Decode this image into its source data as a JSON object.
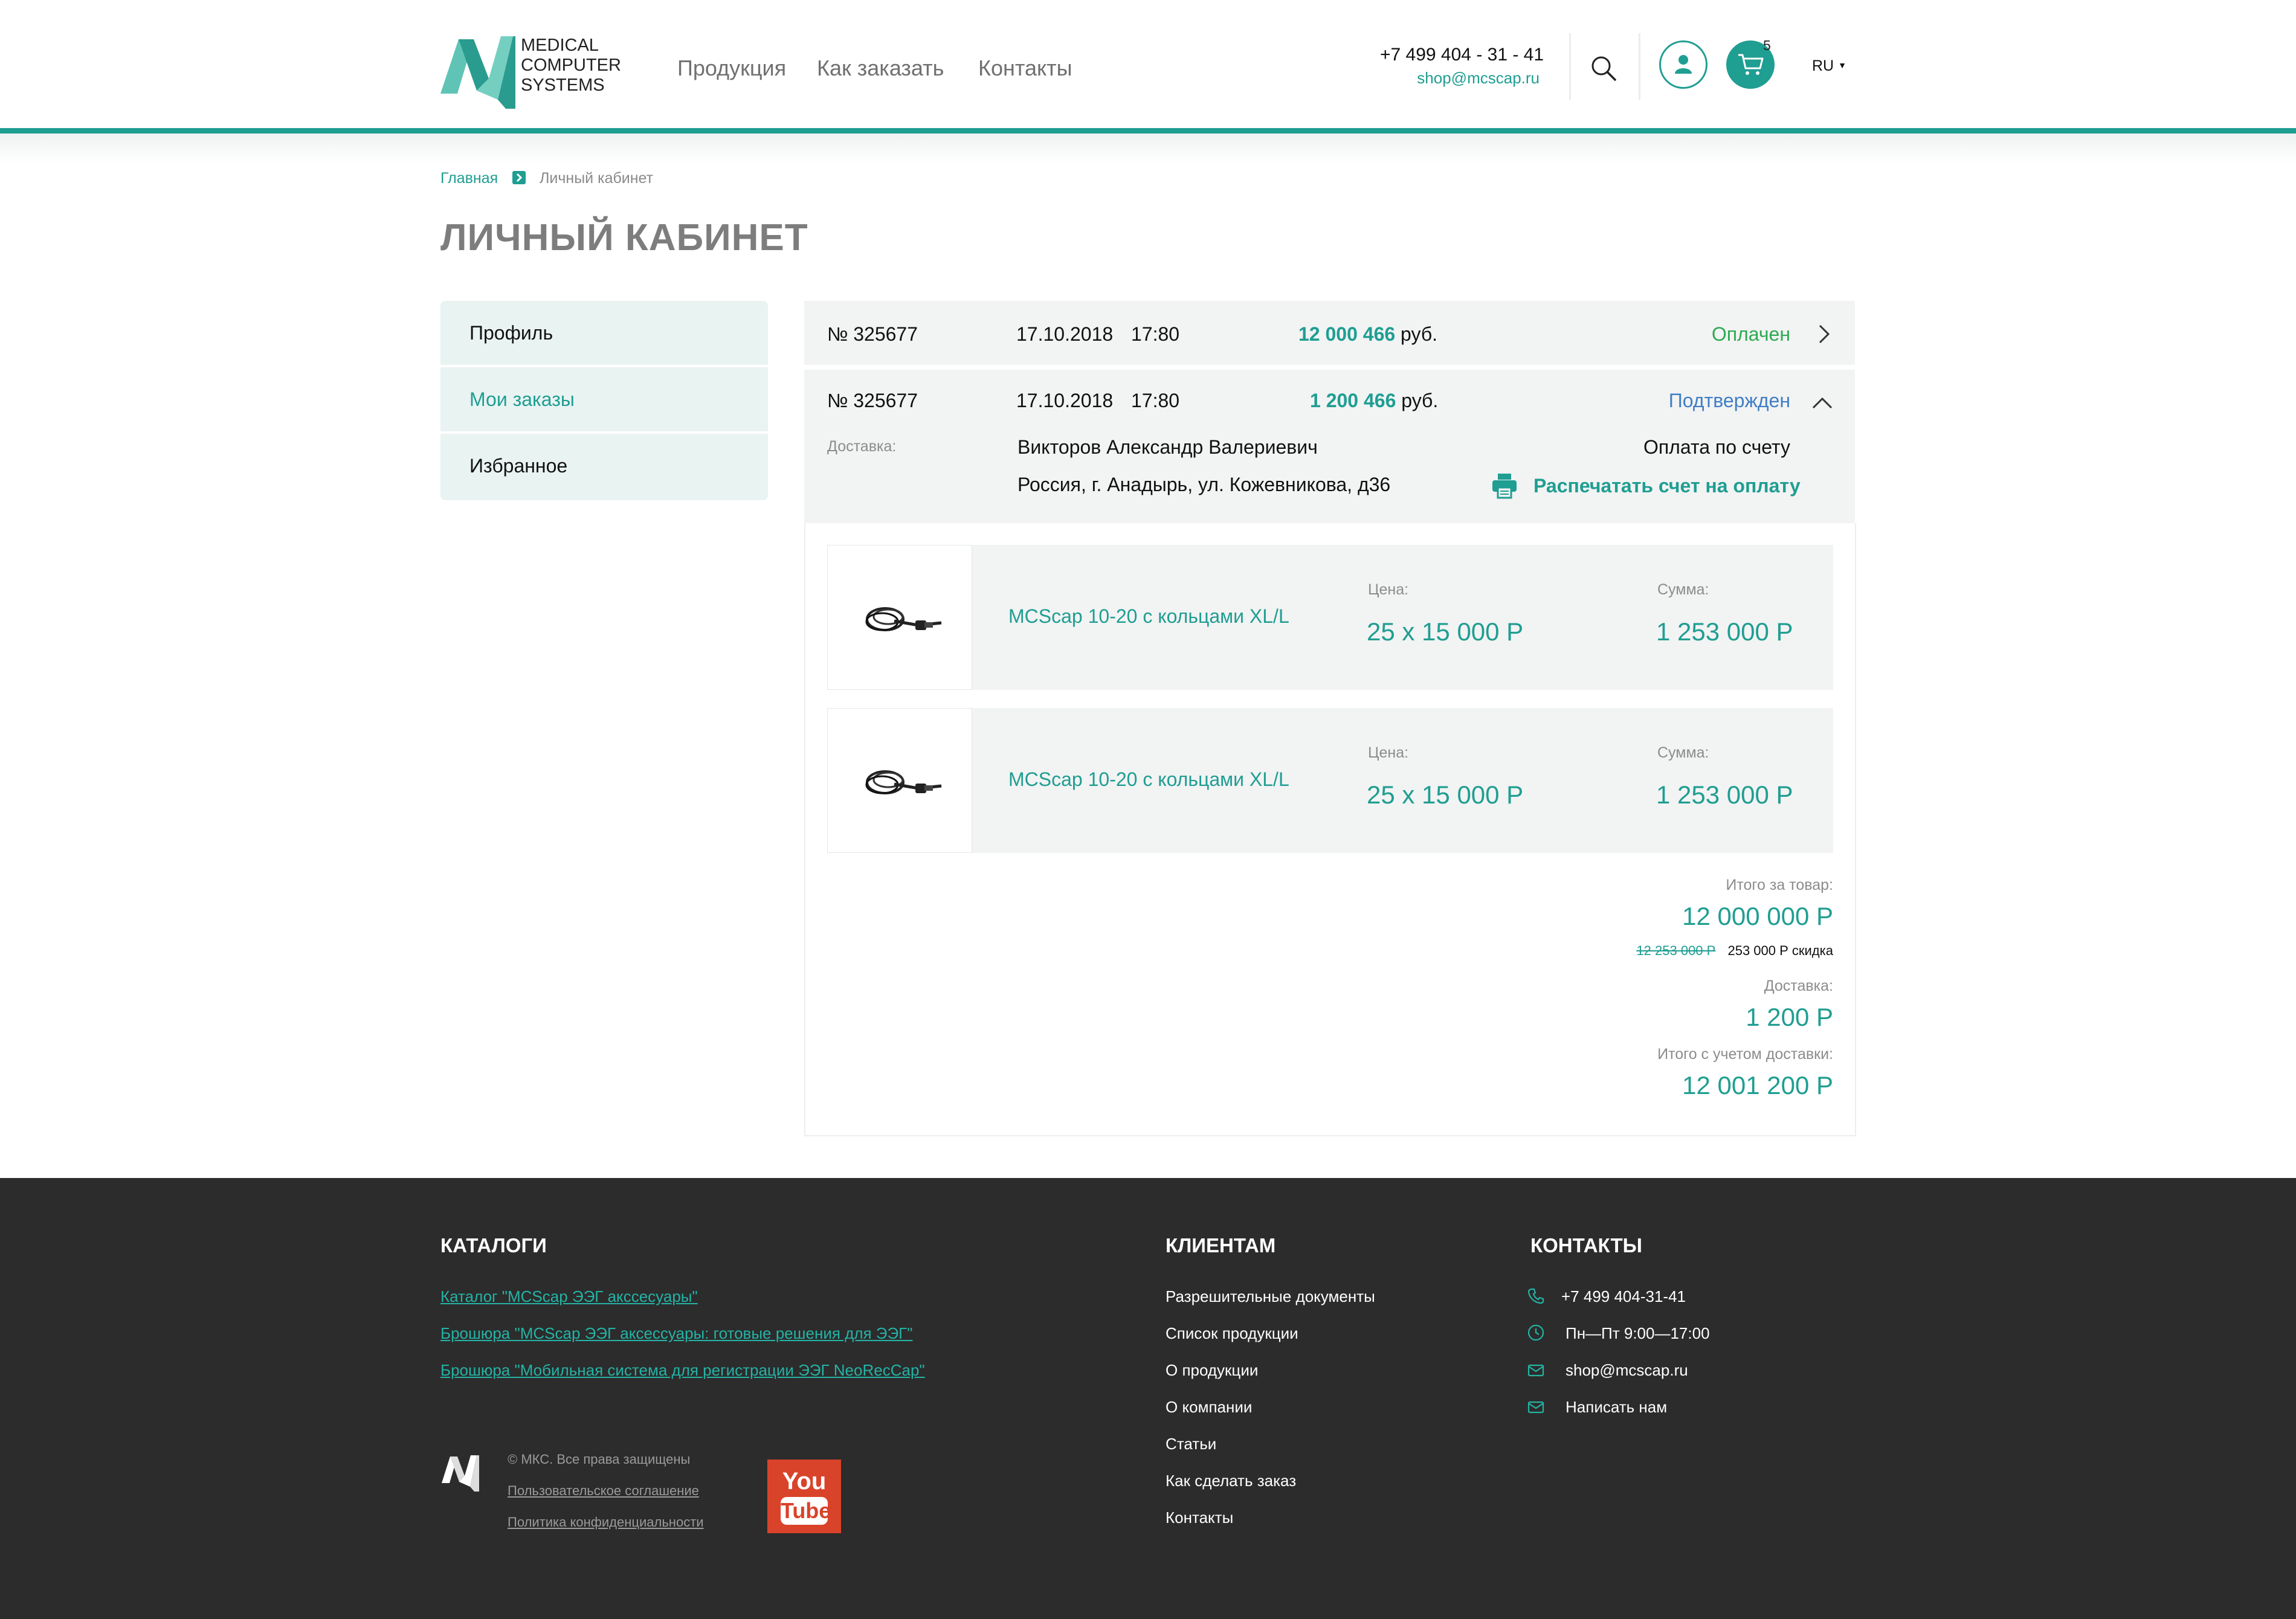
{
  "header": {
    "logo_lines": [
      "MEDICAL",
      "COMPUTER",
      "SYSTEMS"
    ],
    "nav": [
      {
        "label": "Продукция"
      },
      {
        "label": "Как заказать"
      },
      {
        "label": "Контакты"
      }
    ],
    "phone": "+7 499 404 - 31 - 41",
    "email": "shop@mcscap.ru",
    "cart_count": "5",
    "language": "RU"
  },
  "breadcrumb": {
    "home": "Главная",
    "current": "Личный кабинет"
  },
  "page_title": "ЛИЧНЫЙ КАБИНЕТ",
  "sidebar": {
    "items": [
      {
        "label": "Профиль",
        "active": false
      },
      {
        "label": "Мои заказы",
        "active": true
      },
      {
        "label": "Избранное",
        "active": false
      }
    ]
  },
  "orders": [
    {
      "number": "№ 325677",
      "date": "17.10.2018",
      "time": "17:80",
      "amount": "12 000 466",
      "currency": "руб.",
      "status": "Оплачен",
      "status_color": "#2eaa52",
      "expanded": false
    },
    {
      "number": "№ 325677",
      "date": "17.10.2018",
      "time": "17:80",
      "amount": "1 200 466",
      "currency": "руб.",
      "status": "Подтвержден",
      "status_color": "#3f7fc5",
      "expanded": true,
      "delivery_label": "Доставка:",
      "recipient": "Викторов Александр Валериевич",
      "address": "Россия, г. Анадырь, ул. Кожевникова, д36",
      "payment_method": "Оплата по счету",
      "print_label": "Распечатать счет на оплату",
      "items": [
        {
          "name": "MCScap 10-20 с кольцами XL/L",
          "price_label": "Цена:",
          "price": "25 x 15 000 Р",
          "sum_label": "Сумма:",
          "sum": "1 253 000 Р"
        },
        {
          "name": "MCScap 10-20 с кольцами XL/L",
          "price_label": "Цена:",
          "price": "25 x 15 000 Р",
          "sum_label": "Сумма:",
          "sum": "1 253 000 Р"
        }
      ],
      "totals": {
        "goods_label": "Итого за товар:",
        "goods_total": "12 000 000 Р",
        "old_total": "12 253 000 Р",
        "discount": "253 000 Р скидка",
        "delivery_label": "Доставка:",
        "delivery": "1 200 Р",
        "grand_label": "Итого с учетом доставки:",
        "grand_total": "12 001 200 Р"
      }
    }
  ],
  "footer": {
    "catalogs": {
      "heading": "КАТАЛОГИ",
      "links": [
        "Каталог \"MCScap ЭЭГ акссесуары\"",
        "Брошюра \"MCScap ЭЭГ аксессуары: готовые решения для ЭЭГ\"",
        "Брошюра \"Мобильная система для регистрации ЭЭГ NeoRecCap\""
      ]
    },
    "clients": {
      "heading": "КЛИЕНТАМ",
      "links": [
        "Разрешительные документы",
        "Список продукции",
        "О продукции",
        "О компании",
        "Статьи",
        "Как сделать заказ",
        "Контакты"
      ]
    },
    "contacts": {
      "heading": "КОНТАКТЫ",
      "items": [
        {
          "icon": "phone-icon",
          "text": "+7 499 404-31-41"
        },
        {
          "icon": "clock-icon",
          "text": "Пн—Пт 9:00—17:00"
        },
        {
          "icon": "mail-icon",
          "text": "shop@mcscap.ru"
        },
        {
          "icon": "mail-icon",
          "text": "Написать нам"
        }
      ]
    },
    "copyright": "© МКС. Все права защищены",
    "user_agreement": "Пользовательское соглашение",
    "privacy_policy": "Политика конфиденциальности",
    "youtube": [
      "You",
      "Tube"
    ]
  },
  "colors": {
    "accent": "#1f9e92",
    "paid": "#2eaa52",
    "confirmed": "#3f7fc5",
    "footer_bg": "#2c2c2c"
  }
}
